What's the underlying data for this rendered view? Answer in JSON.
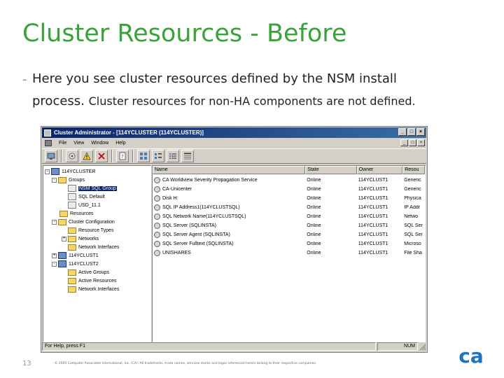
{
  "slide": {
    "title": "Cluster Resources - Before",
    "bullet_dash": "-",
    "bullet_line1": "Here you see cluster resources defined by the NSM install",
    "bullet_line2_start": "process. ",
    "bullet_line2_rest": "Cluster resources for non-HA components are not defined.",
    "page_number": "13",
    "footer": "© 2005 Computer Associates International, Inc. (CA). All trademarks, trade names, services marks and logos referenced herein belong to their respective companies.",
    "logo": "ca",
    "colors": {
      "title": "#3aa23a",
      "logo": "#1e73be",
      "selection": "#0a246a"
    }
  },
  "window": {
    "title": "Cluster Administrator - [114YCLUSTER (114YCLUSTER)]",
    "title_buttons": [
      "_",
      "□",
      "×"
    ],
    "menu": [
      "File",
      "View",
      "Window",
      "Help"
    ],
    "mdi_buttons": [
      "_",
      "□",
      "×"
    ],
    "toolbar_icons": [
      "connect-icon",
      "properties-icon",
      "warning-icon",
      "delete-icon",
      "help-icon",
      "large-icons-icon",
      "small-icons-icon",
      "list-view-icon",
      "details-view-icon"
    ],
    "tree": [
      {
        "label": "114YCLUSTER",
        "icon": "cluster",
        "expander": "-"
      },
      {
        "label": "Groups",
        "icon": "folder",
        "expander": "-"
      },
      {
        "label": "NSM SQL Group",
        "icon": "group",
        "selected": true
      },
      {
        "label": "SQL Default",
        "icon": "group"
      },
      {
        "label": "USD_11.1",
        "icon": "group"
      },
      {
        "label": "Resources",
        "icon": "folder"
      },
      {
        "label": "Cluster Configuration",
        "icon": "folder",
        "expander": "-"
      },
      {
        "label": "Resource Types",
        "icon": "folder"
      },
      {
        "label": "Networks",
        "icon": "folder",
        "expander": "+"
      },
      {
        "label": "Network Interfaces",
        "icon": "folder"
      },
      {
        "label": "114YCLUST1",
        "icon": "node",
        "expander": "+"
      },
      {
        "label": "114YCLUST2",
        "icon": "node",
        "expander": "-"
      },
      {
        "label": "Active Groups",
        "icon": "folder"
      },
      {
        "label": "Active Resources",
        "icon": "folder"
      },
      {
        "label": "Network Interfaces",
        "icon": "folder"
      }
    ],
    "list_columns": [
      "Name",
      "State",
      "Owner",
      "Resou"
    ],
    "list_rows": [
      {
        "name": "CA Worldview Severity Propagation Service",
        "state": "Online",
        "owner": "114YCLUST1",
        "type": "Generic"
      },
      {
        "name": "CA-Unicenter",
        "state": "Online",
        "owner": "114YCLUST1",
        "type": "Generic"
      },
      {
        "name": "Disk H:",
        "state": "Online",
        "owner": "114YCLUST1",
        "type": "Physica"
      },
      {
        "name": "SQL IP Address1(114YCLUSTSQL)",
        "state": "Online",
        "owner": "114YCLUST1",
        "type": "IP Addr"
      },
      {
        "name": "SQL Network Name(114YCLUSTSQL)",
        "state": "Online",
        "owner": "114YCLUST1",
        "type": "Netwo"
      },
      {
        "name": "SQL Server (SQLINSTA)",
        "state": "Online",
        "owner": "114YCLUST1",
        "type": "SQL Ser"
      },
      {
        "name": "SQL Server Agent (SQLINSTA)",
        "state": "Online",
        "owner": "114YCLUST1",
        "type": "SQL Ser"
      },
      {
        "name": "SQL Server Fulltext (SQLINSTA)",
        "state": "Online",
        "owner": "114YCLUST1",
        "type": "Microso"
      },
      {
        "name": "UNISHARES",
        "state": "Online",
        "owner": "114YCLUST1",
        "type": "File Sha"
      }
    ],
    "status_text": "For Help, press F1",
    "status_indicator": "NUM"
  }
}
